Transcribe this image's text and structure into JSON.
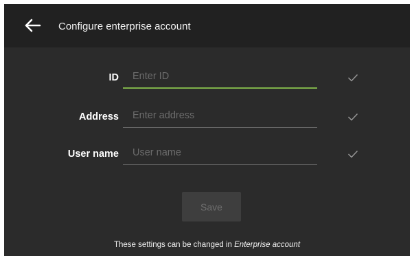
{
  "header": {
    "title": "Configure enterprise account"
  },
  "form": {
    "fields": [
      {
        "label": "ID",
        "placeholder": "Enter ID",
        "value": "",
        "focused": true
      },
      {
        "label": "Address",
        "placeholder": "Enter address",
        "value": "",
        "focused": false
      },
      {
        "label": "User name",
        "placeholder": "User name",
        "value": "",
        "focused": false
      }
    ],
    "save_label": "Save"
  },
  "footer": {
    "prefix": "These settings can be changed in ",
    "link": "Enterprise account"
  },
  "colors": {
    "background": "#2b2b2b",
    "appbar": "#212121",
    "accent": "#7fb24a",
    "check": "#9a9a9a"
  },
  "icons": {
    "back": "back-arrow-icon",
    "check": "checkmark-icon"
  }
}
